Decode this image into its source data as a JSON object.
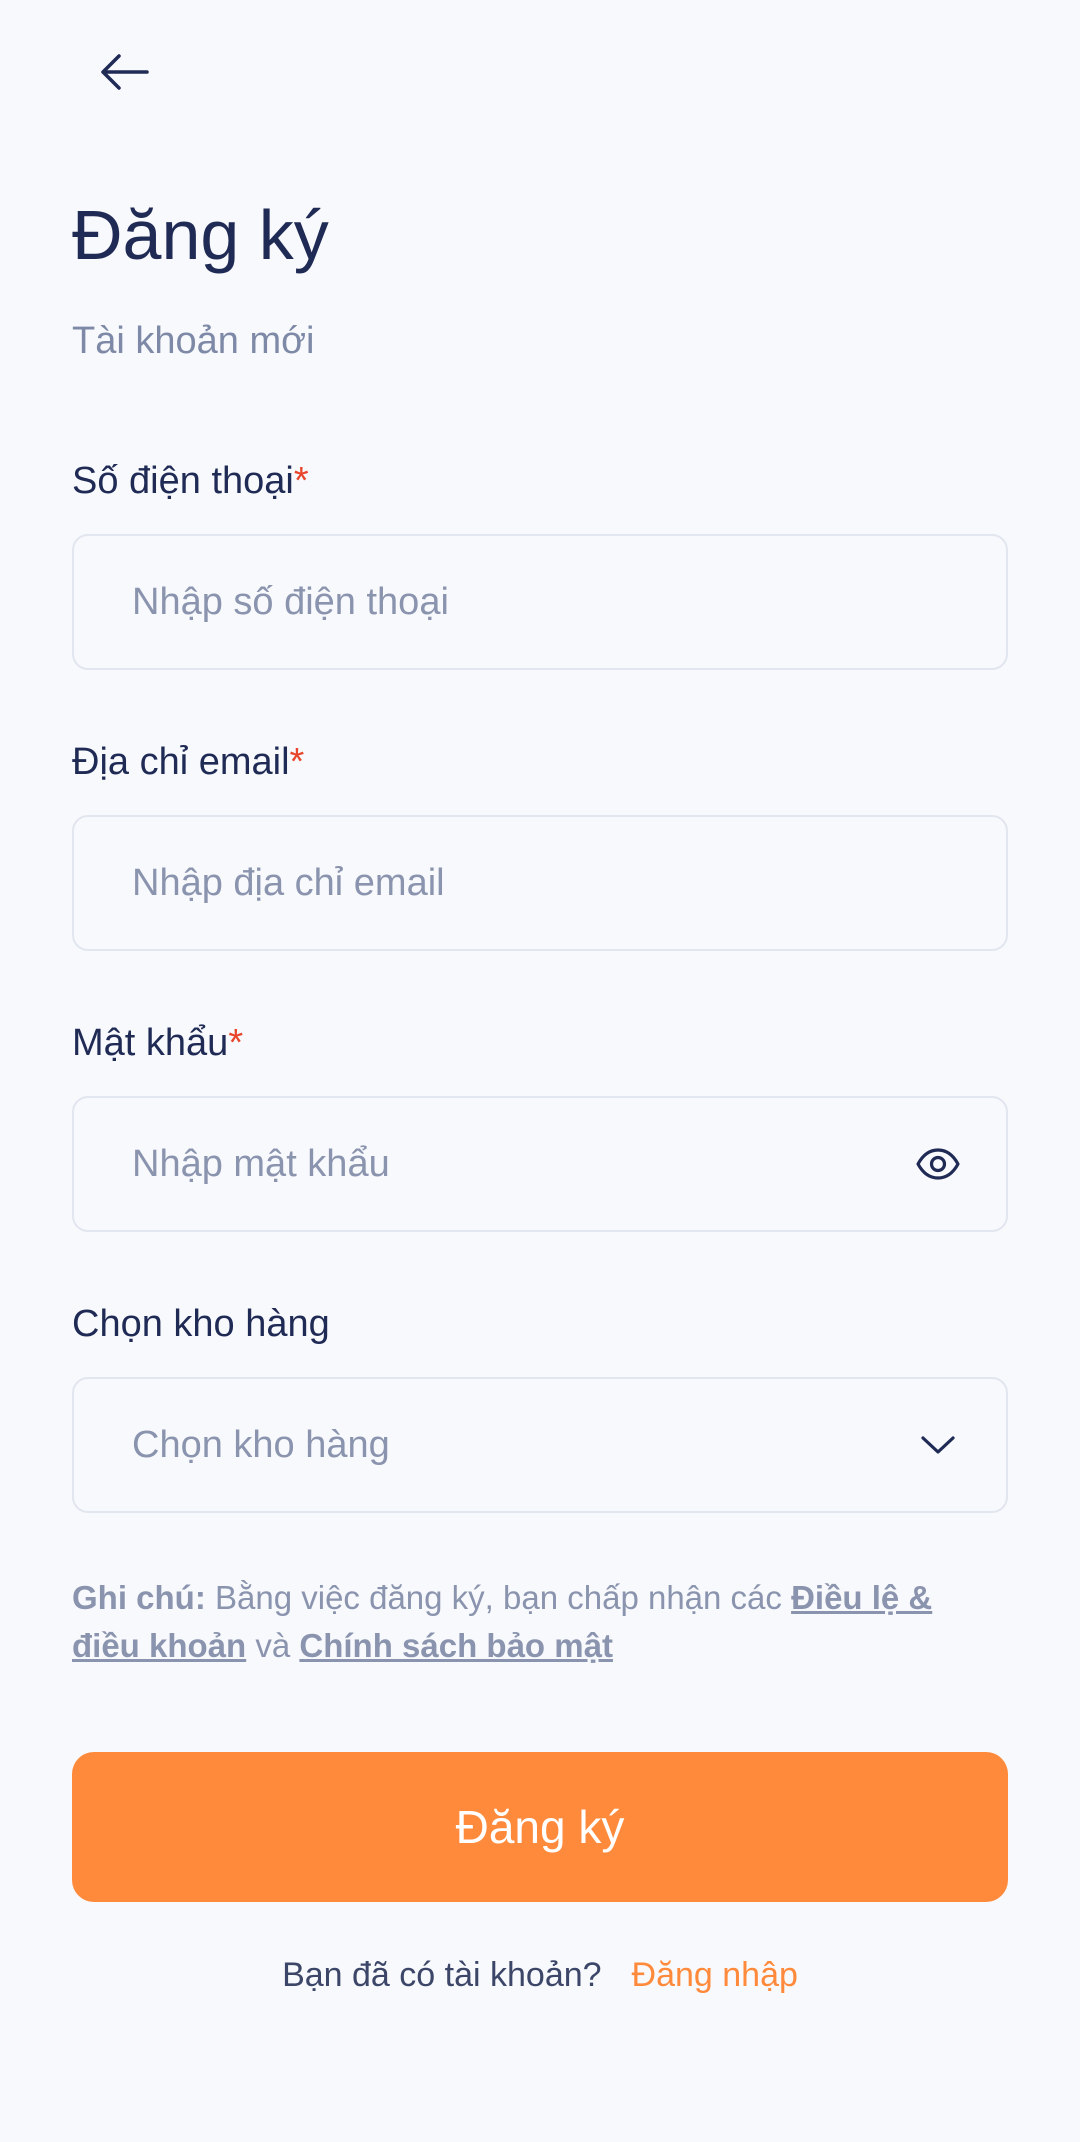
{
  "header": {
    "back_icon": "arrow-left-icon",
    "title": "Đăng ký",
    "subtitle": "Tài khoản mới"
  },
  "form": {
    "phone": {
      "label": "Số điện thoại",
      "required_mark": "*",
      "placeholder": "Nhập số điện thoại",
      "value": ""
    },
    "email": {
      "label": "Địa chỉ email",
      "required_mark": "*",
      "placeholder": "Nhập địa chỉ email",
      "value": ""
    },
    "password": {
      "label": "Mật khẩu",
      "required_mark": "*",
      "placeholder": "Nhập mật khẩu",
      "value": "",
      "toggle_icon": "eye-icon"
    },
    "warehouse": {
      "label": "Chọn kho hàng",
      "selected": "Chọn kho hàng",
      "dropdown_icon": "chevron-down-icon"
    }
  },
  "note": {
    "prefix": "Ghi chú:",
    "text": " Bằng việc đăng ký, bạn chấp nhận các ",
    "terms_link": "Điều lệ & điều khoản",
    "conjunction": " và ",
    "privacy_link": "Chính sách bảo mật"
  },
  "submit": {
    "label": "Đăng ký"
  },
  "footer": {
    "question": "Bạn đã có tài khoản?",
    "login_link": "Đăng nhập"
  },
  "colors": {
    "accent": "#ff8a3c",
    "title": "#1f2a55",
    "muted": "#8a94ae",
    "required": "#e8452b",
    "background": "#f8f9fc",
    "border": "#e1e6ef"
  }
}
